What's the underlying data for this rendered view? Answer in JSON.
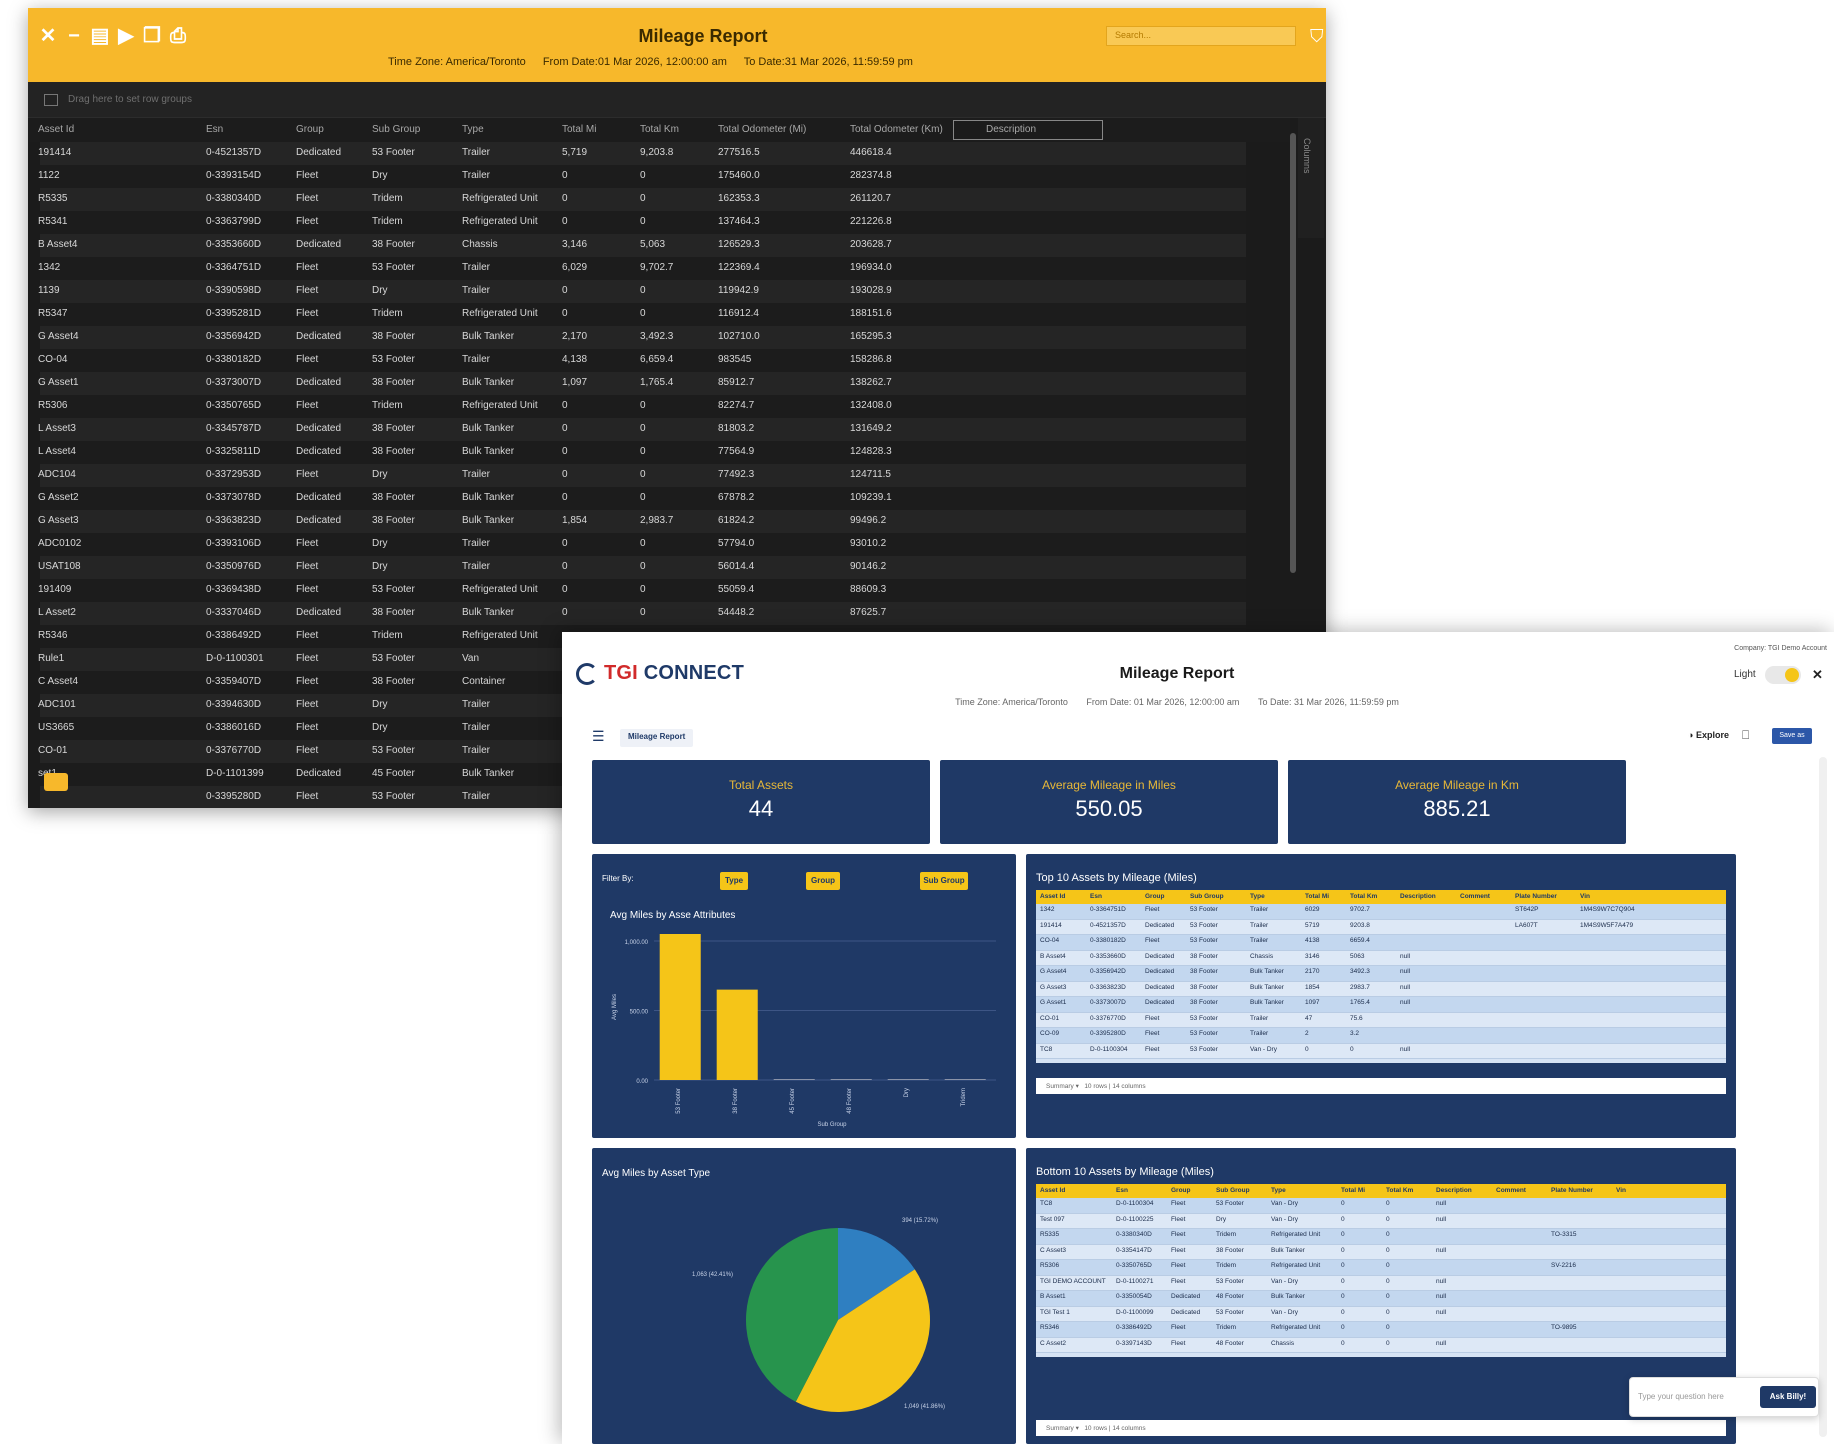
{
  "dark_report": {
    "title": "Mileage Report",
    "timezone": "Time Zone: America/Toronto",
    "from_date": "From Date:01 Mar 2026, 12:00:00 am",
    "to_date": "To Date:31 Mar 2026, 11:59:59 pm",
    "search_placeholder": "Search...",
    "group_hint": "Drag here to set row groups",
    "columns_tab": "Columns",
    "headers": [
      "Asset Id",
      "Esn",
      "Group",
      "Sub Group",
      "Type",
      "Total Mi",
      "Total Km",
      "Total Odometer (Mi)",
      "Total Odometer (Km)",
      "Description"
    ],
    "rows": [
      [
        "191414",
        "0-4521357D",
        "Dedicated",
        "53 Footer",
        "Trailer",
        "5,719",
        "9,203.8",
        "277516.5",
        "446618.4",
        ""
      ],
      [
        "1122",
        "0-3393154D",
        "Fleet",
        "Dry",
        "Trailer",
        "0",
        "0",
        "175460.0",
        "282374.8",
        ""
      ],
      [
        "R5335",
        "0-3380340D",
        "Fleet",
        "Tridem",
        "Refrigerated Unit",
        "0",
        "0",
        "162353.3",
        "261120.7",
        ""
      ],
      [
        "R5341",
        "0-3363799D",
        "Fleet",
        "Tridem",
        "Refrigerated Unit",
        "0",
        "0",
        "137464.3",
        "221226.8",
        ""
      ],
      [
        "B Asset4",
        "0-3353660D",
        "Dedicated",
        "38 Footer",
        "Chassis",
        "3,146",
        "5,063",
        "126529.3",
        "203628.7",
        ""
      ],
      [
        "1342",
        "0-3364751D",
        "Fleet",
        "53 Footer",
        "Trailer",
        "6,029",
        "9,702.7",
        "122369.4",
        "196934.0",
        ""
      ],
      [
        "1139",
        "0-3390598D",
        "Fleet",
        "Dry",
        "Trailer",
        "0",
        "0",
        "119942.9",
        "193028.9",
        ""
      ],
      [
        "R5347",
        "0-3395281D",
        "Fleet",
        "Tridem",
        "Refrigerated Unit",
        "0",
        "0",
        "116912.4",
        "188151.6",
        ""
      ],
      [
        "G Asset4",
        "0-3356942D",
        "Dedicated",
        "38 Footer",
        "Bulk Tanker",
        "2,170",
        "3,492.3",
        "102710.0",
        "165295.3",
        ""
      ],
      [
        "CO-04",
        "0-3380182D",
        "Fleet",
        "53 Footer",
        "Trailer",
        "4,138",
        "6,659.4",
        "983545",
        "158286.8",
        ""
      ],
      [
        "G Asset1",
        "0-3373007D",
        "Dedicated",
        "38 Footer",
        "Bulk Tanker",
        "1,097",
        "1,765.4",
        "85912.7",
        "138262.7",
        ""
      ],
      [
        "R5306",
        "0-3350765D",
        "Fleet",
        "Tridem",
        "Refrigerated Unit",
        "0",
        "0",
        "82274.7",
        "132408.0",
        ""
      ],
      [
        "L Asset3",
        "0-3345787D",
        "Dedicated",
        "38 Footer",
        "Bulk Tanker",
        "0",
        "0",
        "81803.2",
        "131649.2",
        ""
      ],
      [
        "L Asset4",
        "0-3325811D",
        "Dedicated",
        "38 Footer",
        "Bulk Tanker",
        "0",
        "0",
        "77564.9",
        "124828.3",
        ""
      ],
      [
        "ADC104",
        "0-3372953D",
        "Fleet",
        "Dry",
        "Trailer",
        "0",
        "0",
        "77492.3",
        "124711.5",
        ""
      ],
      [
        "G Asset2",
        "0-3373078D",
        "Dedicated",
        "38 Footer",
        "Bulk Tanker",
        "0",
        "0",
        "67878.2",
        "109239.1",
        ""
      ],
      [
        "G Asset3",
        "0-3363823D",
        "Dedicated",
        "38 Footer",
        "Bulk Tanker",
        "1,854",
        "2,983.7",
        "61824.2",
        "99496.2",
        ""
      ],
      [
        "ADC0102",
        "0-3393106D",
        "Fleet",
        "Dry",
        "Trailer",
        "0",
        "0",
        "57794.0",
        "93010.2",
        ""
      ],
      [
        "USAT108",
        "0-3350976D",
        "Fleet",
        "Dry",
        "Trailer",
        "0",
        "0",
        "56014.4",
        "90146.2",
        ""
      ],
      [
        "191409",
        "0-3369438D",
        "Fleet",
        "53 Footer",
        "Refrigerated Unit",
        "0",
        "0",
        "55059.4",
        "88609.3",
        ""
      ],
      [
        "L Asset2",
        "0-3337046D",
        "Dedicated",
        "38 Footer",
        "Bulk Tanker",
        "0",
        "0",
        "54448.2",
        "87625.7",
        ""
      ],
      [
        "R5346",
        "0-3386492D",
        "Fleet",
        "Tridem",
        "Refrigerated Unit",
        "",
        "",
        "",
        "",
        ""
      ],
      [
        "Rule1",
        "D-0-1100301",
        "Fleet",
        "53 Footer",
        "Van",
        "",
        "",
        "",
        "",
        ""
      ],
      [
        "C Asset4",
        "0-3359407D",
        "Fleet",
        "38 Footer",
        "Container",
        "",
        "",
        "",
        "",
        ""
      ],
      [
        "ADC101",
        "0-3394630D",
        "Fleet",
        "Dry",
        "Trailer",
        "",
        "",
        "",
        "",
        ""
      ],
      [
        "US3665",
        "0-3386016D",
        "Fleet",
        "Dry",
        "Trailer",
        "",
        "",
        "",
        "",
        ""
      ],
      [
        "CO-01",
        "0-3376770D",
        "Fleet",
        "53 Footer",
        "Trailer",
        "",
        "",
        "",
        "",
        ""
      ],
      [
        "set1",
        "D-0-1101399",
        "Dedicated",
        "45 Footer",
        "Bulk Tanker",
        "",
        "",
        "",
        "",
        ""
      ],
      [
        "",
        "0-3395280D",
        "Fleet",
        "53 Footer",
        "Trailer",
        "",
        "",
        "",
        "",
        ""
      ]
    ]
  },
  "dashboard": {
    "logo_text": "TGI",
    "logo_text2": "CONNECT",
    "title": "Mileage Report",
    "timezone": "Time Zone: America/Toronto",
    "from_date": "From Date: 01 Mar 2026, 12:00:00 am",
    "to_date": "To Date: 31 Mar 2026, 11:59:59 pm",
    "company": "Company: TGI Demo Account",
    "theme_label": "Light",
    "tab_label": "Mileage Report",
    "explore_label": "Explore",
    "action_label": "Save as",
    "kpis": [
      {
        "label": "Total Assets",
        "value": "44"
      },
      {
        "label": "Average Mileage in Miles",
        "value": "550.05"
      },
      {
        "label": "Average Mileage in Km",
        "value": "885.21"
      }
    ],
    "filter_label": "Filter By:",
    "filters": [
      "Type",
      "Group",
      "Sub Group"
    ],
    "bar_panel_title": "Avg Miles by Asse Attributes",
    "pie_panel_title": "Avg Miles by Asset Type",
    "top_table_title": "Top 10 Assets by Mileage (Miles)",
    "bottom_table_title": "Bottom 10 Assets by Mileage (Miles)",
    "top_headers": [
      "Asset Id",
      "Esn",
      "Group",
      "Sub Group",
      "Type",
      "Total Mi",
      "Total Km",
      "Description",
      "Comment",
      "Plate Number",
      "Vin"
    ],
    "top_rows": [
      [
        "1342",
        "0-3364751D",
        "Fleet",
        "53 Footer",
        "Trailer",
        "6029",
        "9702.7",
        "",
        "",
        "ST642P",
        "1M4S9W7C7Q904"
      ],
      [
        "191414",
        "0-4521357D",
        "Dedicated",
        "53 Footer",
        "Trailer",
        "5719",
        "9203.8",
        "",
        "",
        "LA607T",
        "1M4S9W5F7A479"
      ],
      [
        "CO-04",
        "0-3380182D",
        "Fleet",
        "53 Footer",
        "Trailer",
        "4138",
        "6659.4",
        "",
        "",
        "",
        ""
      ],
      [
        "B Asset4",
        "0-3353660D",
        "Dedicated",
        "38 Footer",
        "Chassis",
        "3146",
        "5063",
        "null",
        "",
        "",
        ""
      ],
      [
        "G Asset4",
        "0-3356942D",
        "Dedicated",
        "38 Footer",
        "Bulk Tanker",
        "2170",
        "3492.3",
        "null",
        "",
        "",
        ""
      ],
      [
        "G Asset3",
        "0-3363823D",
        "Dedicated",
        "38 Footer",
        "Bulk Tanker",
        "1854",
        "2983.7",
        "null",
        "",
        "",
        ""
      ],
      [
        "G Asset1",
        "0-3373007D",
        "Dedicated",
        "38 Footer",
        "Bulk Tanker",
        "1097",
        "1765.4",
        "null",
        "",
        "",
        ""
      ],
      [
        "CO-01",
        "0-3376770D",
        "Fleet",
        "53 Footer",
        "Trailer",
        "47",
        "75.6",
        "",
        "",
        "",
        ""
      ],
      [
        "CO-09",
        "0-3395280D",
        "Fleet",
        "53 Footer",
        "Trailer",
        "2",
        "3.2",
        "",
        "",
        "",
        ""
      ],
      [
        "TC8",
        "D-0-1100304",
        "Fleet",
        "53 Footer",
        "Van - Dry",
        "0",
        "0",
        "null",
        "",
        "",
        ""
      ]
    ],
    "top_footer": "Summary",
    "top_footer_count": "10 rows | 14 columns",
    "bottom_headers": [
      "Asset Id",
      "Esn",
      "Group",
      "Sub Group",
      "Type",
      "Total Mi",
      "Total Km",
      "Description",
      "Comment",
      "Plate Number",
      "Vin"
    ],
    "bottom_rows": [
      [
        "TC8",
        "D-0-1100304",
        "Fleet",
        "53 Footer",
        "Van - Dry",
        "0",
        "0",
        "null",
        "",
        "",
        ""
      ],
      [
        "Test 097",
        "D-0-1100225",
        "Fleet",
        "Dry",
        "Van - Dry",
        "0",
        "0",
        "null",
        "",
        "",
        ""
      ],
      [
        "R5335",
        "0-3380340D",
        "Fleet",
        "Tridem",
        "Refrigerated Unit",
        "0",
        "0",
        "",
        "",
        "TO-3315",
        ""
      ],
      [
        "C Asset3",
        "0-3354147D",
        "Fleet",
        "38 Footer",
        "Bulk Tanker",
        "0",
        "0",
        "null",
        "",
        "",
        ""
      ],
      [
        "R5306",
        "0-3350765D",
        "Fleet",
        "Tridem",
        "Refrigerated Unit",
        "0",
        "0",
        "",
        "",
        "SV-2216",
        ""
      ],
      [
        "TGI DEMO ACCOUNT",
        "D-0-1100271",
        "Fleet",
        "53 Footer",
        "Van - Dry",
        "0",
        "0",
        "null",
        "",
        "",
        ""
      ],
      [
        "B Asset1",
        "0-3350054D",
        "Dedicated",
        "48 Footer",
        "Bulk Tanker",
        "0",
        "0",
        "null",
        "",
        "",
        ""
      ],
      [
        "TGI Test 1",
        "D-0-1100099",
        "Dedicated",
        "53 Footer",
        "Van - Dry",
        "0",
        "0",
        "null",
        "",
        "",
        ""
      ],
      [
        "R5346",
        "0-3386492D",
        "Fleet",
        "Tridem",
        "Refrigerated Unit",
        "0",
        "0",
        "",
        "",
        "TO-9895",
        ""
      ],
      [
        "C Asset2",
        "0-3397143D",
        "Fleet",
        "48 Footer",
        "Chassis",
        "0",
        "0",
        "null",
        "",
        "",
        ""
      ]
    ],
    "bottom_footer": "Summary",
    "bottom_footer_count": "10 rows | 14 columns",
    "ask_placeholder": "Type your question here",
    "ask_button": "Ask Billy!"
  },
  "chart_data": [
    {
      "type": "bar",
      "title": "Avg Miles by Asse Attributes",
      "xlabel": "Sub Group",
      "ylabel": "Avg Miles",
      "categories": [
        "53 Footer",
        "38 Footer",
        "45 Footer",
        "48 Footer",
        "Dry",
        "Tridem"
      ],
      "values": [
        1050,
        650,
        0,
        0,
        0,
        0
      ],
      "yticks": [
        "1,000.00",
        "500.00",
        "0.00"
      ],
      "ylim": [
        0,
        1050
      ],
      "color": "#f5c518",
      "grid": true
    },
    {
      "type": "pie",
      "title": "Avg Miles by Asset Type",
      "slices": [
        {
          "label": "394 (15.72%)",
          "value": 15.72,
          "color": "#2f7fc1"
        },
        {
          "label": "1,049 (41.86%)",
          "value": 41.86,
          "color": "#f5c518"
        },
        {
          "label": "1,063 (42.41%)",
          "value": 42.41,
          "color": "#27944d"
        }
      ]
    }
  ]
}
